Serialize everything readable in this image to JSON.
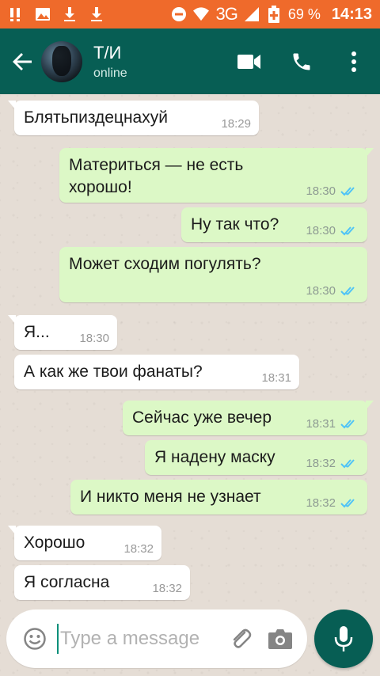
{
  "status_bar": {
    "network": "3G",
    "battery_percent": "69 %",
    "time": "14:13"
  },
  "header": {
    "contact_name": "Т/И",
    "contact_status": "online"
  },
  "messages": [
    {
      "direction": "in",
      "text": "Блятьпиздецнахуй",
      "time": "18:29"
    },
    {
      "direction": "out",
      "text": "Материться — не есть хорошо!",
      "time": "18:30",
      "read": true
    },
    {
      "direction": "out",
      "text": "Ну так что?",
      "time": "18:30",
      "read": true
    },
    {
      "direction": "out",
      "text": "Может сходим погулять?",
      "time": "18:30",
      "read": true
    },
    {
      "direction": "in",
      "text": "Я...",
      "time": "18:30"
    },
    {
      "direction": "in",
      "text": "А как же твои фанаты?",
      "time": "18:31"
    },
    {
      "direction": "out",
      "text": "Сейчас уже вечер",
      "time": "18:31",
      "read": true
    },
    {
      "direction": "out",
      "text": "Я надену маску",
      "time": "18:32",
      "read": true
    },
    {
      "direction": "out",
      "text": "И никто меня не узнает",
      "time": "18:32",
      "read": true
    },
    {
      "direction": "in",
      "text": "Хорошо",
      "time": "18:32"
    },
    {
      "direction": "in",
      "text": "Я согласна",
      "time": "18:32"
    }
  ],
  "composer": {
    "placeholder": "Type a message"
  },
  "colors": {
    "status_bar": "#ef6a2b",
    "app_bar": "#075e54",
    "incoming_bubble": "#ffffff",
    "outgoing_bubble": "#dcf8c6",
    "read_ticks": "#4fc3f7"
  }
}
